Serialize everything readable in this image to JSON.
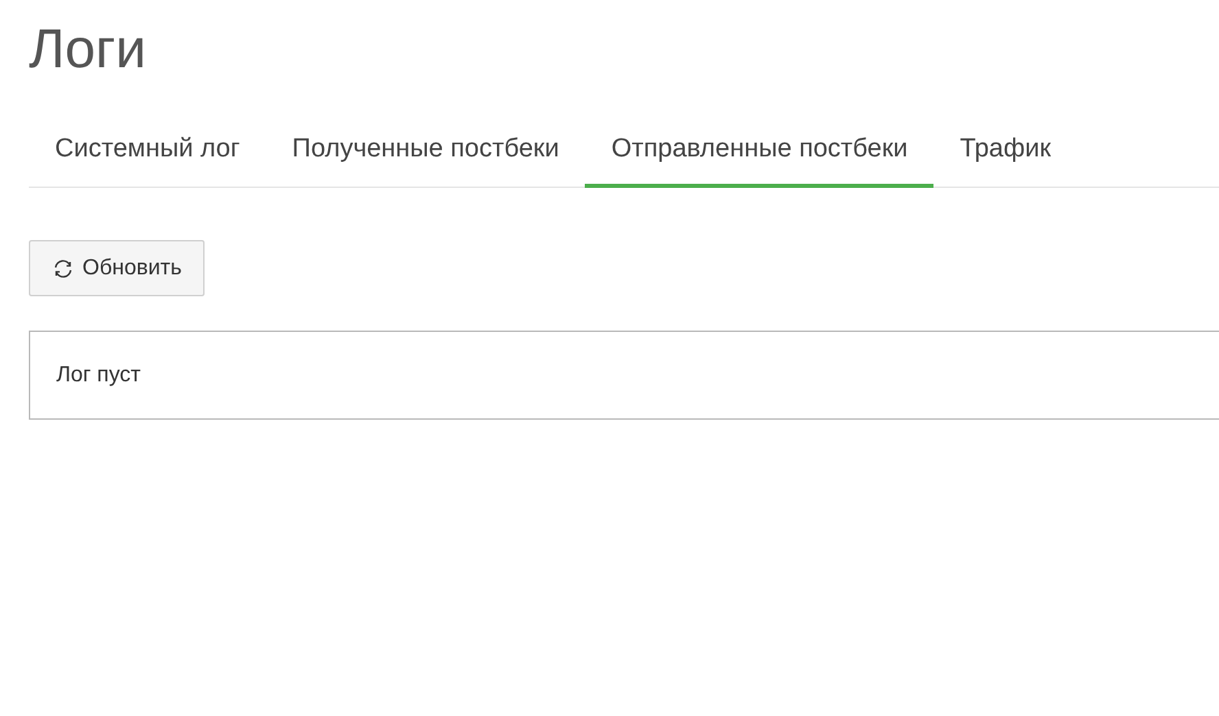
{
  "page": {
    "title": "Логи"
  },
  "tabs": [
    {
      "label": "Системный лог",
      "selected": false
    },
    {
      "label": "Полученные постбеки",
      "selected": false
    },
    {
      "label": "Отправленные постбеки",
      "selected": true
    },
    {
      "label": "Трафик",
      "selected": false
    }
  ],
  "refresh_button": {
    "label": "Обновить"
  },
  "log_panel": {
    "message": "Лог пуст"
  }
}
